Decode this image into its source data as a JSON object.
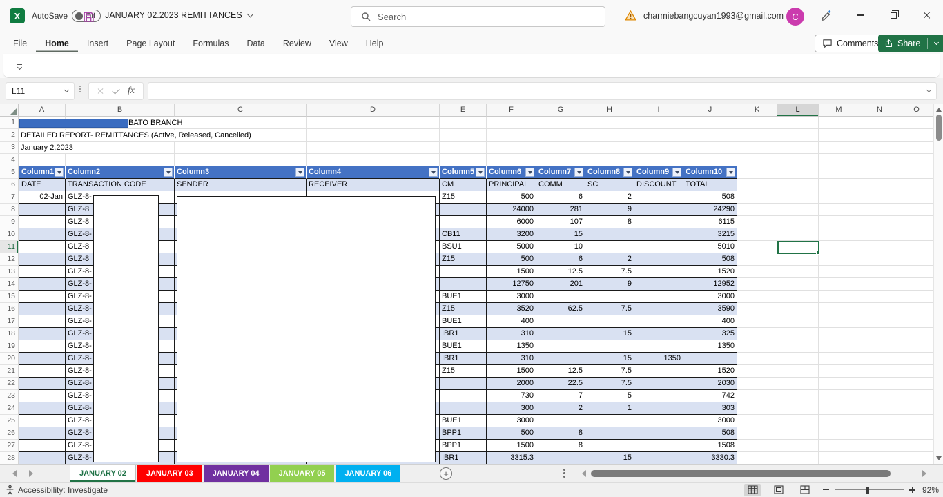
{
  "titlebar": {
    "app_initial": "X",
    "autosave_label": "AutoSave",
    "autosave_state": "Off",
    "doc_title": "JANUARY 02.2023 REMITTANCES",
    "search_placeholder": "Search",
    "account_email": "charmiebangcuyan1993@gmail.com",
    "avatar_initial": "C"
  },
  "ribbon": {
    "tabs": [
      "File",
      "Home",
      "Insert",
      "Page Layout",
      "Formulas",
      "Data",
      "Review",
      "View",
      "Help"
    ],
    "active_tab": "Home",
    "comments_label": "Comments",
    "share_label": "Share"
  },
  "formula_bar": {
    "name_box": "L11",
    "fx": "fx",
    "value": ""
  },
  "sheet": {
    "columns": [
      "A",
      "B",
      "C",
      "D",
      "E",
      "F",
      "G",
      "H",
      "I",
      "J",
      "K",
      "L",
      "M",
      "N",
      "O"
    ],
    "row_count": 28,
    "selected_cell": "L11",
    "selected_column": "L",
    "selected_row": 11,
    "titles": {
      "row1": "BATO BRANCH",
      "row2": "DETAILED REPORT- REMITTANCES (Active, Released, Cancelled)",
      "row3": "January 2,2023"
    },
    "table_headers": [
      "Column1",
      "Column2",
      "Column3",
      "Column4",
      "Column5",
      "Column6",
      "Column7",
      "Column8",
      "Column9",
      "Column10"
    ],
    "field_labels": [
      "DATE",
      "TRANSACTION CODE",
      "SENDER",
      "RECEIVER",
      "CM",
      "PRINCIPAL",
      "COMM",
      "SC",
      "DISCOUNT",
      "TOTAL"
    ],
    "rows": [
      {
        "n": 7,
        "date": "02-Jan",
        "code": "GLZ-8-",
        "cm": "Z15",
        "principal": "500",
        "comm": "6",
        "sc": "2",
        "discount": "",
        "total": "508"
      },
      {
        "n": 8,
        "date": "",
        "code": "GLZ-8",
        "cm": "",
        "principal": "24000",
        "comm": "281",
        "sc": "9",
        "discount": "",
        "total": "24290"
      },
      {
        "n": 9,
        "date": "",
        "code": "GLZ-8",
        "cm": "",
        "principal": "6000",
        "comm": "107",
        "sc": "8",
        "discount": "",
        "total": "6115"
      },
      {
        "n": 10,
        "date": "",
        "code": "GLZ-8-",
        "cm": "CB11",
        "principal": "3200",
        "comm": "15",
        "sc": "",
        "discount": "",
        "total": "3215"
      },
      {
        "n": 11,
        "date": "",
        "code": "GLZ-8",
        "cm": "BSU1",
        "principal": "5000",
        "comm": "10",
        "sc": "",
        "discount": "",
        "total": "5010"
      },
      {
        "n": 12,
        "date": "",
        "code": "GLZ-8",
        "cm": "Z15",
        "principal": "500",
        "comm": "6",
        "sc": "2",
        "discount": "",
        "total": "508"
      },
      {
        "n": 13,
        "date": "",
        "code": "GLZ-8-",
        "cm": "",
        "principal": "1500",
        "comm": "12.5",
        "sc": "7.5",
        "discount": "",
        "total": "1520"
      },
      {
        "n": 14,
        "date": "",
        "code": "GLZ-8-",
        "cm": "",
        "principal": "12750",
        "comm": "201",
        "sc": "9",
        "discount": "",
        "total": "12952"
      },
      {
        "n": 15,
        "date": "",
        "code": "GLZ-8-",
        "cm": "BUE1",
        "principal": "3000",
        "comm": "",
        "sc": "",
        "discount": "",
        "total": "3000"
      },
      {
        "n": 16,
        "date": "",
        "code": "GLZ-8-",
        "cm": "Z15",
        "principal": "3520",
        "comm": "62.5",
        "sc": "7.5",
        "discount": "",
        "total": "3590"
      },
      {
        "n": 17,
        "date": "",
        "code": "GLZ-8-",
        "cm": "BUE1",
        "principal": "400",
        "comm": "",
        "sc": "",
        "discount": "",
        "total": "400"
      },
      {
        "n": 18,
        "date": "",
        "code": "GLZ-8-",
        "cm": "IBR1",
        "principal": "310",
        "comm": "",
        "sc": "15",
        "discount": "",
        "total": "325"
      },
      {
        "n": 19,
        "date": "",
        "code": "GLZ-8-",
        "cm": "BUE1",
        "principal": "1350",
        "comm": "",
        "sc": "",
        "discount": "",
        "total": "1350"
      },
      {
        "n": 20,
        "date": "",
        "code": "GLZ-8-",
        "cm": "IBR1",
        "principal": "310",
        "comm": "",
        "sc": "15",
        "discount": "1350",
        "total": ""
      },
      {
        "n": 21,
        "date": "",
        "code": "GLZ-8-",
        "cm": "Z15",
        "principal": "1500",
        "comm": "12.5",
        "sc": "7.5",
        "discount": "",
        "total": "1520"
      },
      {
        "n": 22,
        "date": "",
        "code": "GLZ-8-",
        "cm": "",
        "principal": "2000",
        "comm": "22.5",
        "sc": "7.5",
        "discount": "",
        "total": "2030"
      },
      {
        "n": 23,
        "date": "",
        "code": "GLZ-8-",
        "cm": "",
        "principal": "730",
        "comm": "7",
        "sc": "5",
        "discount": "",
        "total": "742"
      },
      {
        "n": 24,
        "date": "",
        "code": "GLZ-8-",
        "cm": "",
        "principal": "300",
        "comm": "2",
        "sc": "1",
        "discount": "",
        "total": "303"
      },
      {
        "n": 25,
        "date": "",
        "code": "GLZ-8-",
        "cm": "BUE1",
        "principal": "3000",
        "comm": "",
        "sc": "",
        "discount": "",
        "total": "3000"
      },
      {
        "n": 26,
        "date": "",
        "code": "GLZ-8-",
        "cm": "BPP1",
        "principal": "500",
        "comm": "8",
        "sc": "",
        "discount": "",
        "total": "508"
      },
      {
        "n": 27,
        "date": "",
        "code": "GLZ-8-",
        "cm": "BPP1",
        "principal": "1500",
        "comm": "8",
        "sc": "",
        "discount": "",
        "total": "1508"
      },
      {
        "n": 28,
        "date": "",
        "code": "GLZ-8-",
        "cm": "IBR1",
        "principal": "3315.3",
        "comm": "",
        "sc": "15",
        "discount": "",
        "total": "3330.3"
      }
    ]
  },
  "sheet_tabs": {
    "tabs": [
      {
        "label": "JANUARY 02",
        "bg": "#FFFFFF",
        "text": "#1E7145",
        "active": true
      },
      {
        "label": "JANUARY 03",
        "bg": "#FF0000",
        "text": "#FFFFFF",
        "active": false
      },
      {
        "label": "JANUARY 04",
        "bg": "#7030A0",
        "text": "#FFFFFF",
        "active": false
      },
      {
        "label": "JANUARY 05",
        "bg": "#92D050",
        "text": "#FFFFFF",
        "active": false
      },
      {
        "label": "JANUARY 06",
        "bg": "#00B0F0",
        "text": "#FFFFFF",
        "active": false
      }
    ],
    "add_label": "+"
  },
  "status_bar": {
    "accessibility": "Accessibility: Investigate",
    "zoom_level": "92%"
  },
  "colors": {
    "accent_green": "#217346",
    "table_header_blue": "#4472C4",
    "band_blue": "#D9E1F2",
    "redaction_blue": "#3A6CC0",
    "tab_red": "#FF0000",
    "tab_purple": "#7030A0",
    "tab_green": "#92D050",
    "tab_cyan": "#00B0F0"
  }
}
